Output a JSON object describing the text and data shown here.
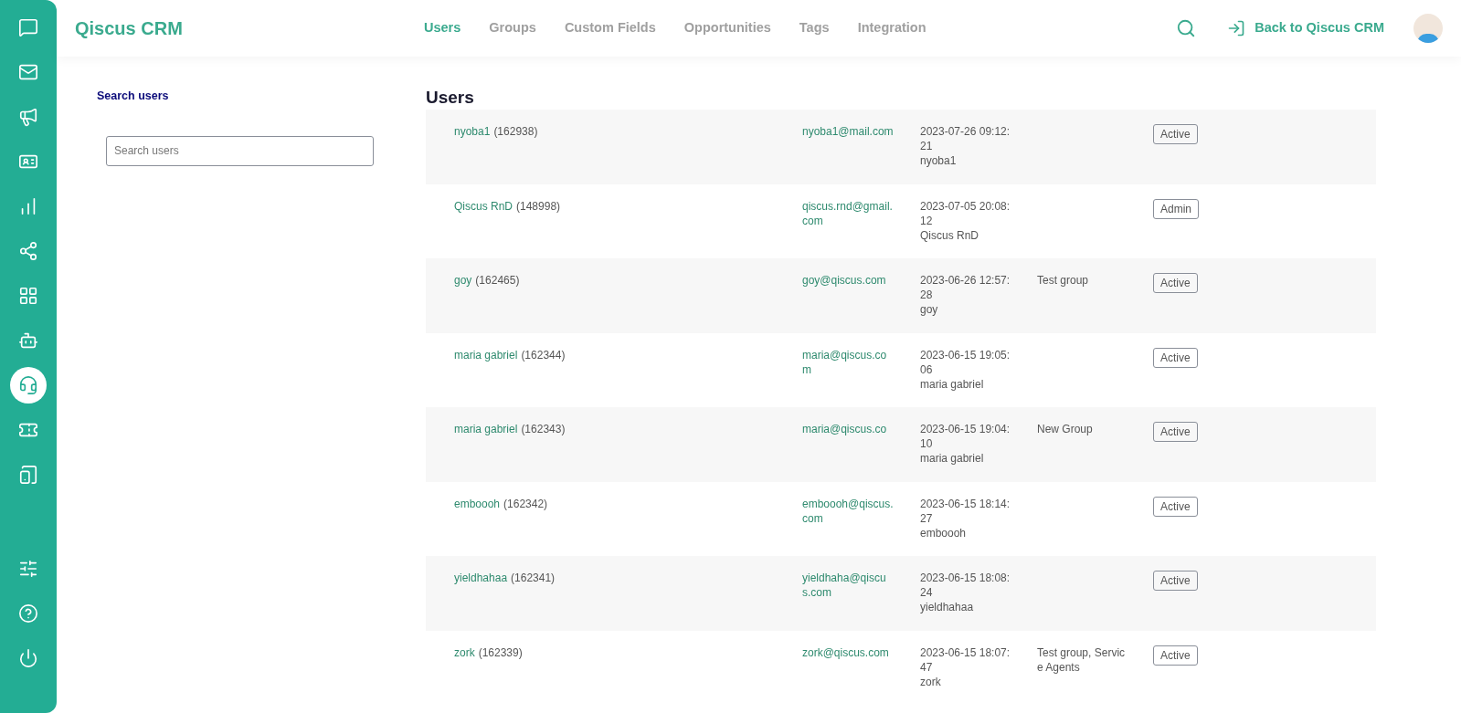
{
  "sidebar": {
    "items": [
      {
        "selected": false
      },
      {
        "selected": false
      },
      {
        "selected": false
      },
      {
        "selected": false
      },
      {
        "selected": false
      },
      {
        "selected": false
      },
      {
        "selected": false
      },
      {
        "selected": false
      },
      {
        "selected": true
      },
      {
        "selected": false
      },
      {
        "selected": false
      }
    ],
    "bottom_items": [
      {
        "selected": false
      },
      {
        "selected": false
      },
      {
        "selected": false
      }
    ]
  },
  "header": {
    "brand": "Qiscus CRM",
    "nav": [
      {
        "label": "Users",
        "selected": true
      },
      {
        "label": "Groups",
        "selected": false
      },
      {
        "label": "Custom Fields",
        "selected": false
      },
      {
        "label": "Opportunities",
        "selected": false
      },
      {
        "label": "Tags",
        "selected": false
      },
      {
        "label": "Integration",
        "selected": false
      }
    ],
    "back_link": "Back to Qiscus CRM"
  },
  "search": {
    "title": "Search users",
    "placeholder": "Search users"
  },
  "users": {
    "title": "Users",
    "rows": [
      {
        "name": "nyoba1",
        "id": "(162938)",
        "email": "nyoba1@mail.com",
        "date": "2023-07-26 09:12:21",
        "by": "nyoba1",
        "groups": "",
        "status": "Active"
      },
      {
        "name": "Qiscus RnD",
        "id": "(148998)",
        "email": "qiscus.rnd@gmail.com",
        "date": "2023-07-05 20:08:12",
        "by": "Qiscus RnD",
        "groups": "",
        "status": "Admin"
      },
      {
        "name": "goy",
        "id": "(162465)",
        "email": "goy@qiscus.com",
        "date": "2023-06-26 12:57:28",
        "by": "goy",
        "groups": "Test group",
        "status": "Active"
      },
      {
        "name": "maria gabriel",
        "id": "(162344)",
        "email": "maria@qiscus.com",
        "date": "2023-06-15 19:05:06",
        "by": "maria gabriel",
        "groups": "",
        "status": "Active"
      },
      {
        "name": "maria gabriel",
        "id": "(162343)",
        "email": "maria@qiscus.co",
        "date": "2023-06-15 19:04:10",
        "by": "maria gabriel",
        "groups": "New Group",
        "status": "Active"
      },
      {
        "name": "emboooh",
        "id": "(162342)",
        "email": "emboooh@qiscus.com",
        "date": "2023-06-15 18:14:27",
        "by": "emboooh",
        "groups": "",
        "status": "Active"
      },
      {
        "name": "yieldhahaa",
        "id": "(162341)",
        "email": "yieldhaha@qiscus.com",
        "date": "2023-06-15 18:08:24",
        "by": "yieldhahaa",
        "groups": "",
        "status": "Active"
      },
      {
        "name": "zork",
        "id": "(162339)",
        "email": "zork@qiscus.com",
        "date": "2023-06-15 18:07:47",
        "by": "zork",
        "groups": "Test group, Service Agents",
        "status": "Active"
      }
    ]
  }
}
